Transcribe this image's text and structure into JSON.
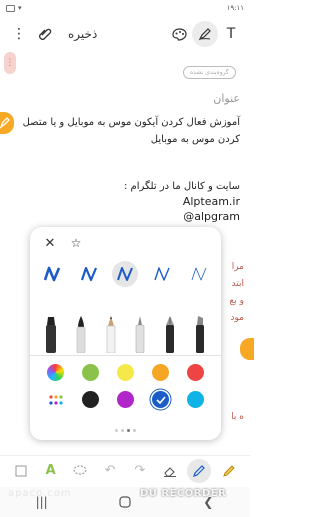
{
  "status_bar": {
    "time": "۱۹:۱۱"
  },
  "toolbar": {
    "save_label": "ذخیره",
    "text_mode_label": "T"
  },
  "note": {
    "category_chip": "گروه‌بندی نشده",
    "title_placeholder": "عنوان",
    "body_line1": "آموزش فعال کردن آیکون موس به موبایل و یا متصل کردن موس به موبایل",
    "body_line2": "سایت و کانال ما در تلگرام :",
    "body_line3": "Alpteam.ir",
    "body_line4": "@alpgram",
    "partial_right_1": "مرا",
    "partial_right_2": "ابتد",
    "partial_right_3": "و بع",
    "partial_right_4": "مود",
    "partial_right_5": "ه با"
  },
  "pen_panel": {
    "strokes": [
      "fountain-pen",
      "pen",
      "pencil-selected",
      "calligraphy",
      "brush-thin"
    ],
    "selected_stroke_index": 2,
    "tools": [
      "marker",
      "brush",
      "pencil",
      "pen",
      "fountain-pen",
      "calligraphy-pen"
    ],
    "colors_row1": [
      "#rainbow",
      "#8bc34a",
      "#f5e94a",
      "#f5a623",
      "#ef4444"
    ],
    "colors_row2": [
      "#palette",
      "#222222",
      "#b026c9",
      "#1b5cc8",
      "#0fb3e6"
    ],
    "selected_color": "#1b5cc8",
    "page_dots": 4,
    "active_page_dot": 2
  },
  "bottom_bar": {
    "tools": [
      "color-picker",
      "text-style",
      "lasso",
      "undo",
      "redo",
      "eraser",
      "pen",
      "highlighter"
    ],
    "selected_tool": "pen"
  },
  "watermark": {
    "right": "DU RECORDER",
    "left": "apaco.com"
  }
}
